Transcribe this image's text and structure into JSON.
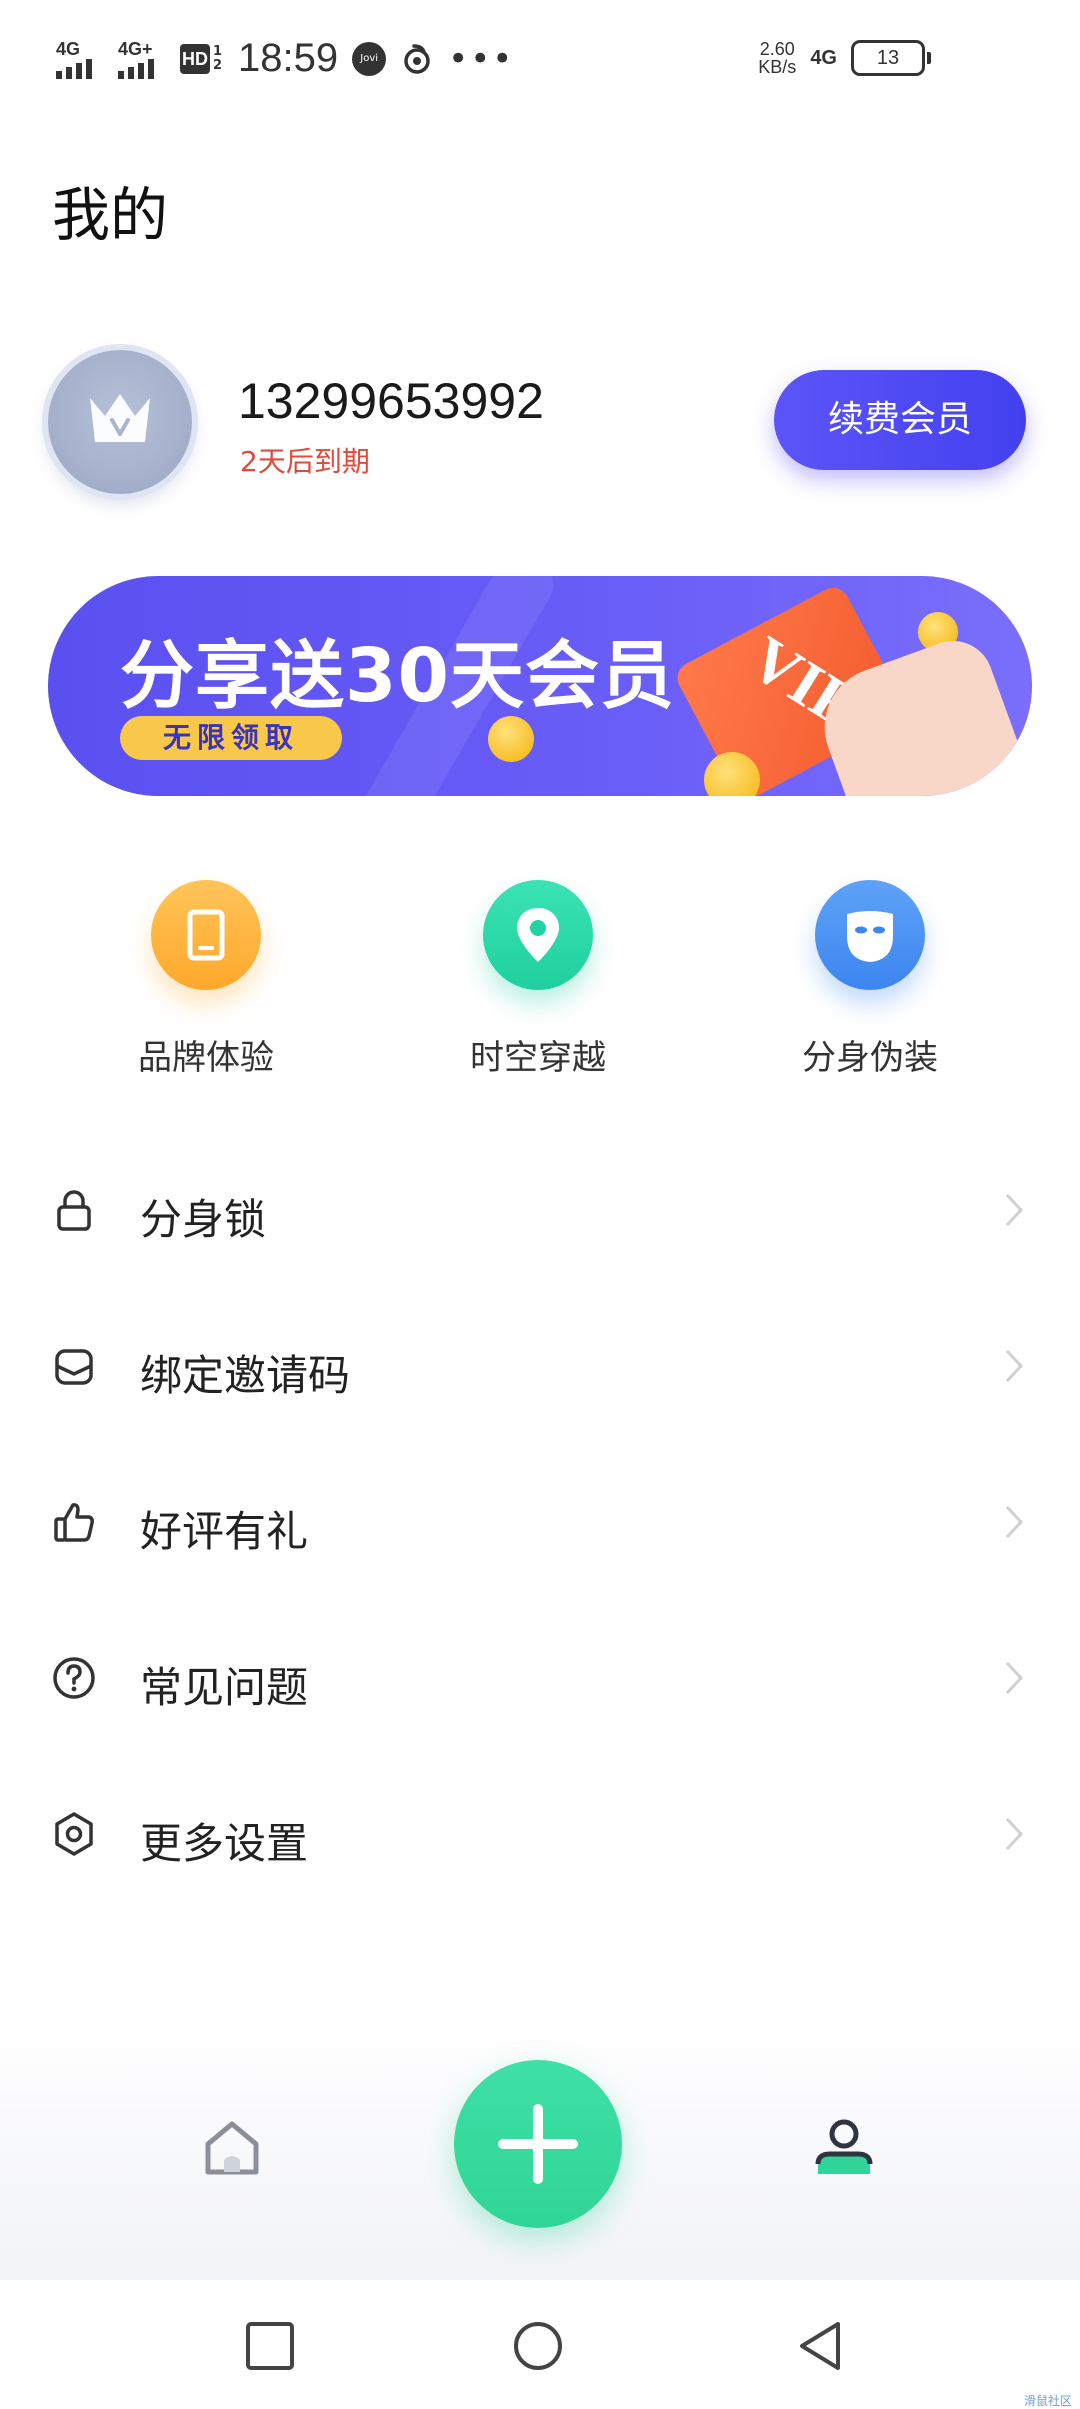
{
  "status_bar": {
    "network1": "4G",
    "network2": "4G+",
    "hd": "HD",
    "hd_sub1": "1",
    "hd_sub2": "2",
    "time": "18:59",
    "jovi": "Jovi",
    "more": "•••",
    "speed_value": "2.60",
    "speed_unit": "KB/s",
    "network_type": "4G",
    "battery": "13"
  },
  "page": {
    "title": "我的"
  },
  "profile": {
    "phone": "13299653992",
    "expire_text": "2天后到期",
    "renew_label": "续费会员"
  },
  "banner": {
    "title": "分享送30天会员",
    "subtitle": "无限领取",
    "card_text": "VIP"
  },
  "features": [
    {
      "label": "品牌体验",
      "icon": "phone-icon",
      "color": "#ffb13d"
    },
    {
      "label": "时空穿越",
      "icon": "location-pin-icon",
      "color": "#27d9a9"
    },
    {
      "label": "分身伪装",
      "icon": "mask-icon",
      "color": "#4a93f5"
    }
  ],
  "menu": [
    {
      "label": "分身锁",
      "icon": "lock-icon"
    },
    {
      "label": "绑定邀请码",
      "icon": "envelope-icon"
    },
    {
      "label": "好评有礼",
      "icon": "thumbs-up-icon"
    },
    {
      "label": "常见问题",
      "icon": "question-icon"
    },
    {
      "label": "更多设置",
      "icon": "settings-icon"
    }
  ],
  "tabbar": {
    "home_icon": "home-icon",
    "add_icon": "plus-icon",
    "me_icon": "user-icon",
    "accent": "#2fd596"
  },
  "system_nav": [
    "recent-apps-icon",
    "home-circle-icon",
    "back-icon"
  ],
  "watermark": "滑鼠社区"
}
